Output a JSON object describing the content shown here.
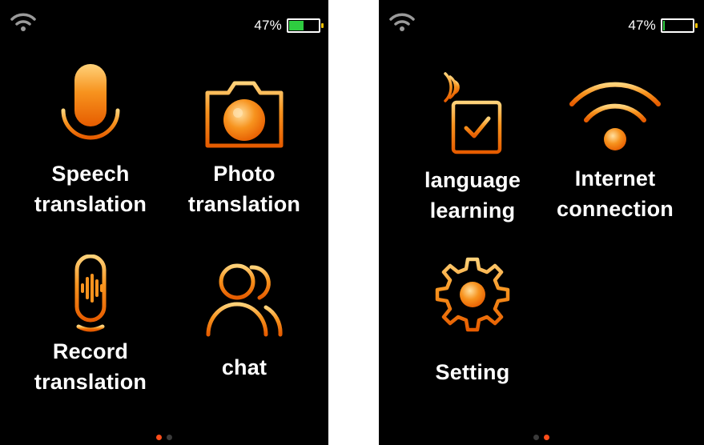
{
  "accent": "#f39c12",
  "screen1": {
    "battery": {
      "percent_text": "47%",
      "level": 0.47
    },
    "tiles": [
      {
        "icon": "microphone-icon",
        "line1": "Speech",
        "line2": "translation"
      },
      {
        "icon": "camera-icon",
        "line1": "Photo",
        "line2": "translation"
      },
      {
        "icon": "voice-record-icon",
        "line1": "Record",
        "line2": "translation"
      },
      {
        "icon": "users-icon",
        "line1": "chat"
      }
    ],
    "page_indicator": {
      "active": 1,
      "total": 2
    }
  },
  "screen2": {
    "battery": {
      "percent_text": "47%",
      "level": 0.05
    },
    "tiles": [
      {
        "icon": "language-learning-icon",
        "line1": "language",
        "line2": "learning"
      },
      {
        "icon": "wifi-large-icon",
        "line1": "Internet",
        "line2": "connection"
      },
      {
        "icon": "gear-icon",
        "line1": "Setting"
      }
    ],
    "page_indicator": {
      "active": 2,
      "total": 2
    }
  }
}
